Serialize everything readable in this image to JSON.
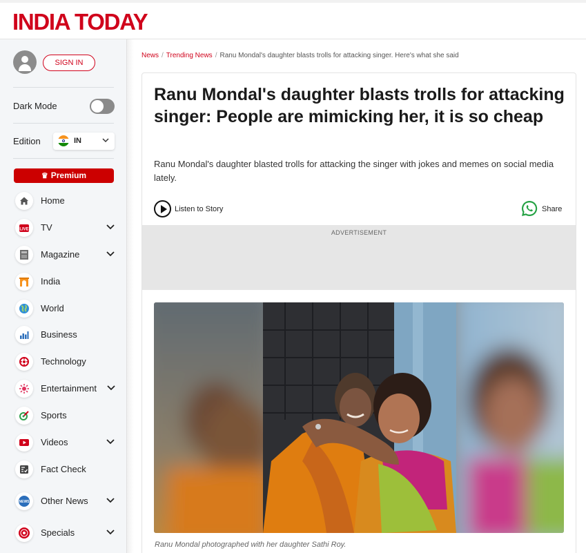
{
  "header": {
    "logo": "INDIA TODAY"
  },
  "sidebar": {
    "sign_in": "SIGN IN",
    "dark_mode_label": "Dark Mode",
    "dark_mode_on": false,
    "edition_label": "Edition",
    "edition_code": "IN",
    "premium_label": "Premium",
    "items": [
      {
        "label": "Home",
        "icon": "home-icon",
        "has_submenu": false
      },
      {
        "label": "TV",
        "icon": "live-tv-icon",
        "has_submenu": true
      },
      {
        "label": "Magazine",
        "icon": "magazine-icon",
        "has_submenu": true
      },
      {
        "label": "India",
        "icon": "india-gate-icon",
        "has_submenu": false
      },
      {
        "label": "World",
        "icon": "globe-icon",
        "has_submenu": false
      },
      {
        "label": "Business",
        "icon": "bar-chart-icon",
        "has_submenu": false
      },
      {
        "label": "Technology",
        "icon": "technology-icon",
        "has_submenu": false
      },
      {
        "label": "Entertainment",
        "icon": "entertainment-icon",
        "has_submenu": true
      },
      {
        "label": "Sports",
        "icon": "sports-icon",
        "has_submenu": false
      },
      {
        "label": "Videos",
        "icon": "video-play-icon",
        "has_submenu": true
      },
      {
        "label": "Fact Check",
        "icon": "fact-check-icon",
        "has_submenu": false
      },
      {
        "label": "Other News",
        "icon": "news-icon",
        "has_submenu": true
      },
      {
        "label": "Specials",
        "icon": "specials-icon",
        "has_submenu": true
      }
    ]
  },
  "breadcrumb": {
    "items": [
      "News",
      "Trending News"
    ],
    "current": "Ranu Mondal's daughter blasts trolls for attacking singer. Here's what she said"
  },
  "article": {
    "title": "Ranu Mondal's daughter blasts trolls for attacking singer: People are mimicking her, it is so cheap",
    "summary": "Ranu Mondal's daughter blasted trolls for attacking the singer with jokes and memes on social media lately.",
    "listen_label": "Listen to Story",
    "share_label": "Share",
    "ad_label": "ADVERTISEMENT",
    "image_caption": "Ranu Mondal photographed with her daughter Sathi Roy."
  },
  "colors": {
    "brand_red": "#d0021b",
    "whatsapp_green": "#25a244",
    "sidebar_bg": "#f4f6f8"
  }
}
